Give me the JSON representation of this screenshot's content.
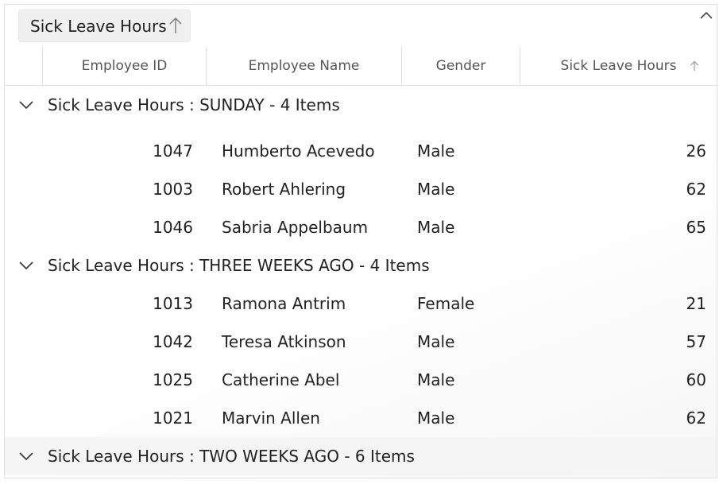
{
  "group_area": {
    "chip_label": "Sick Leave Hours",
    "chip_sort": "ascending"
  },
  "columns": {
    "employee_id": "Employee ID",
    "employee_name": "Employee Name",
    "gender": "Gender",
    "sick_leave_hours": "Sick Leave Hours"
  },
  "groups": [
    {
      "caption": "Sick Leave Hours : SUNDAY - 4 Items",
      "expanded": true,
      "rows": [
        {
          "id": "1047",
          "name": "Humberto Acevedo",
          "gender": "Male",
          "hours": "26"
        },
        {
          "id": "1003",
          "name": "Robert Ahlering",
          "gender": "Male",
          "hours": "62"
        },
        {
          "id": "1046",
          "name": "Sabria Appelbaum",
          "gender": "Male",
          "hours": "65"
        }
      ]
    },
    {
      "caption": "Sick Leave Hours : THREE WEEKS AGO - 4 Items",
      "expanded": true,
      "rows": [
        {
          "id": "1013",
          "name": "Ramona Antrim",
          "gender": "Female",
          "hours": "21"
        },
        {
          "id": "1042",
          "name": "Teresa Atkinson",
          "gender": "Male",
          "hours": "57"
        },
        {
          "id": "1025",
          "name": "Catherine Abel",
          "gender": "Male",
          "hours": "60"
        },
        {
          "id": "1021",
          "name": "Marvin Allen",
          "gender": "Male",
          "hours": "62"
        }
      ]
    },
    {
      "caption": "Sick Leave Hours : TWO WEEKS AGO - 6 Items",
      "expanded": true,
      "rows": []
    }
  ]
}
